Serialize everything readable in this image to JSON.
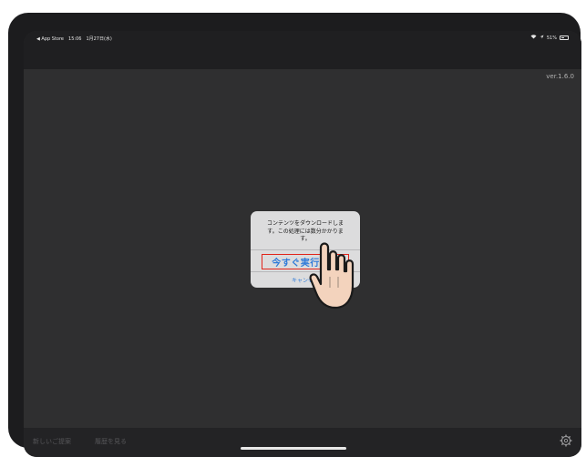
{
  "status_bar": {
    "back_app": "◀ App Store",
    "time": "15:06",
    "date": "1月27日(水)",
    "battery": "51%"
  },
  "version": "ver.1.6.0",
  "alert": {
    "message": "コンテンツをダウンロードしま\nす。この処理には数分かかりま\nす。",
    "primary_button": "今すぐ実行する",
    "cancel_button": "キャンセル"
  },
  "bottom_bar": {
    "item1": "新しいご提案",
    "item2": "履歴を見る"
  },
  "colors": {
    "accent": "#2f7bd9",
    "highlight": "#e1251b",
    "background": "#2f2f30"
  },
  "icons": [
    "back-arrow-icon",
    "wifi-icon",
    "location-icon",
    "battery-icon",
    "settings-icon",
    "pointing-hand-icon"
  ]
}
